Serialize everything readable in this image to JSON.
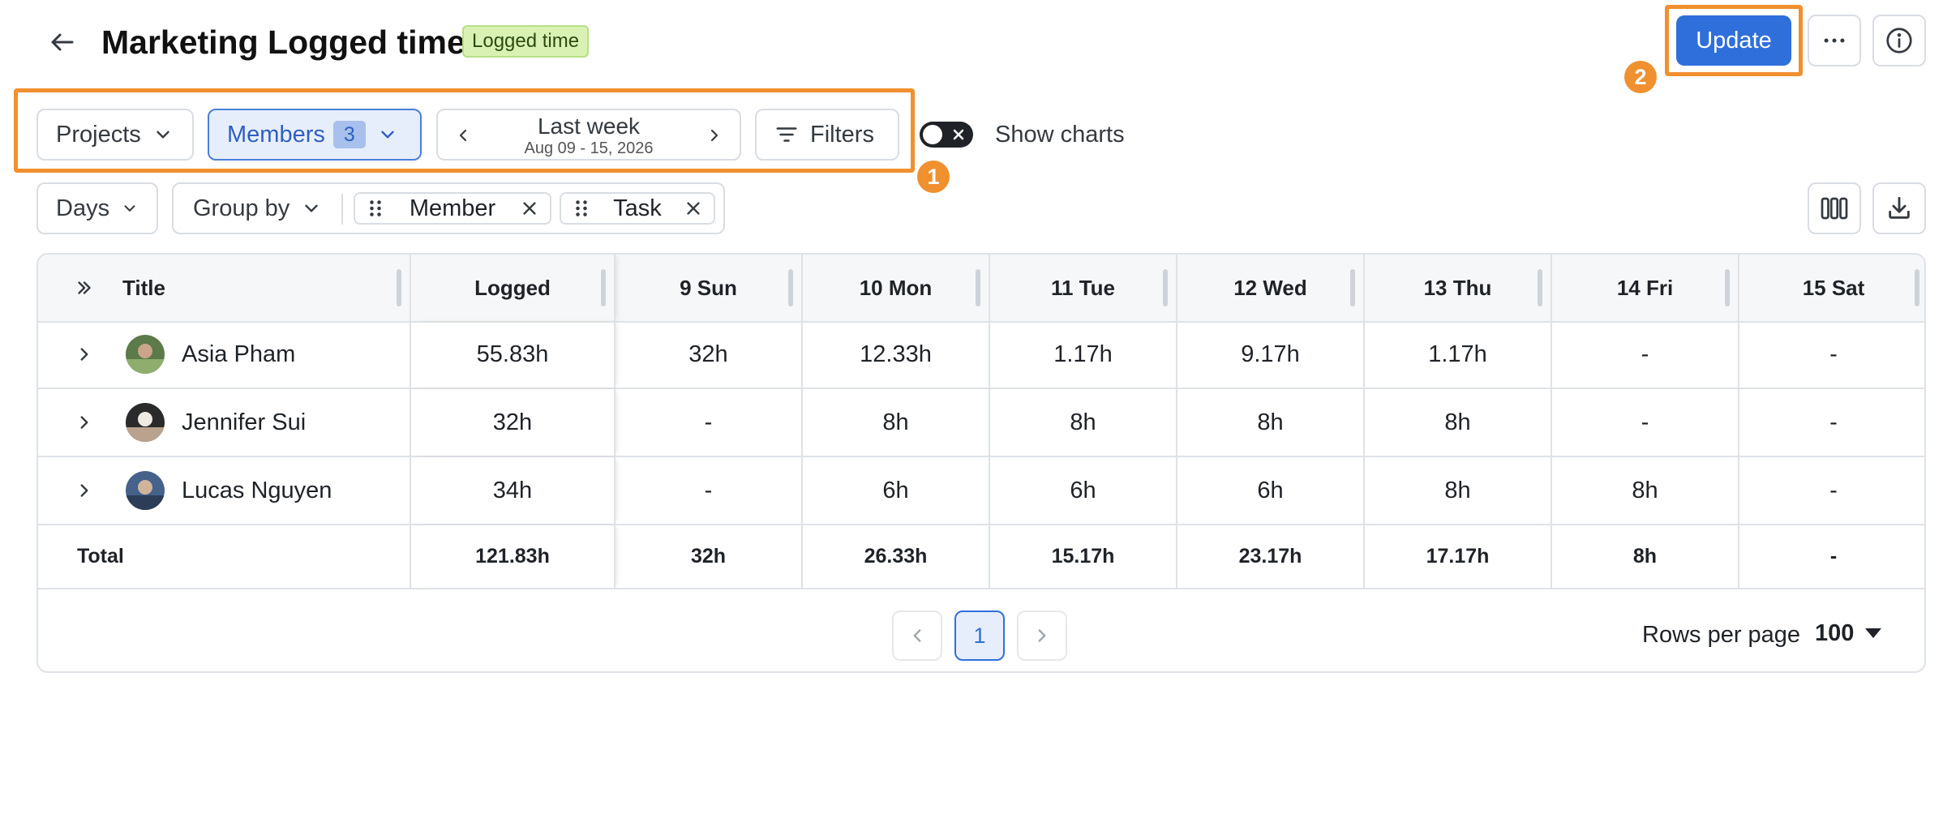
{
  "header": {
    "title": "Marketing Logged time",
    "tag": "Logged time",
    "update_label": "Update"
  },
  "toolbar": {
    "projects_label": "Projects",
    "members_label": "Members",
    "members_count": "3",
    "date_label": "Last week",
    "date_range": "Aug 09 - 15, 2026",
    "filters_label": "Filters",
    "show_charts_label": "Show charts",
    "days_label": "Days",
    "group_by_label": "Group by",
    "group_chips": [
      "Member",
      "Task"
    ]
  },
  "annotations": {
    "one": "1",
    "two": "2"
  },
  "table": {
    "columns": [
      "Title",
      "Logged",
      "9 Sun",
      "10 Mon",
      "11 Tue",
      "12 Wed",
      "13 Thu",
      "14 Fri",
      "15 Sat"
    ],
    "rows": [
      {
        "name": "Asia Pham",
        "cells": [
          "55.83h",
          "32h",
          "12.33h",
          "1.17h",
          "9.17h",
          "1.17h",
          "-",
          "-"
        ]
      },
      {
        "name": "Jennifer Sui",
        "cells": [
          "32h",
          "-",
          "8h",
          "8h",
          "8h",
          "8h",
          "-",
          "-"
        ]
      },
      {
        "name": "Lucas Nguyen",
        "cells": [
          "34h",
          "-",
          "6h",
          "6h",
          "6h",
          "8h",
          "8h",
          "-"
        ]
      }
    ],
    "total": {
      "label": "Total",
      "cells": [
        "121.83h",
        "32h",
        "26.33h",
        "15.17h",
        "23.17h",
        "17.17h",
        "8h",
        "-"
      ]
    }
  },
  "pagination": {
    "page": "1",
    "rows_per_page_label": "Rows per page",
    "rows_per_page_value": "100"
  },
  "colors": {
    "accent": "#2f6fdc",
    "highlight": "#f0902f",
    "tag_bg": "#d9f2b4"
  }
}
